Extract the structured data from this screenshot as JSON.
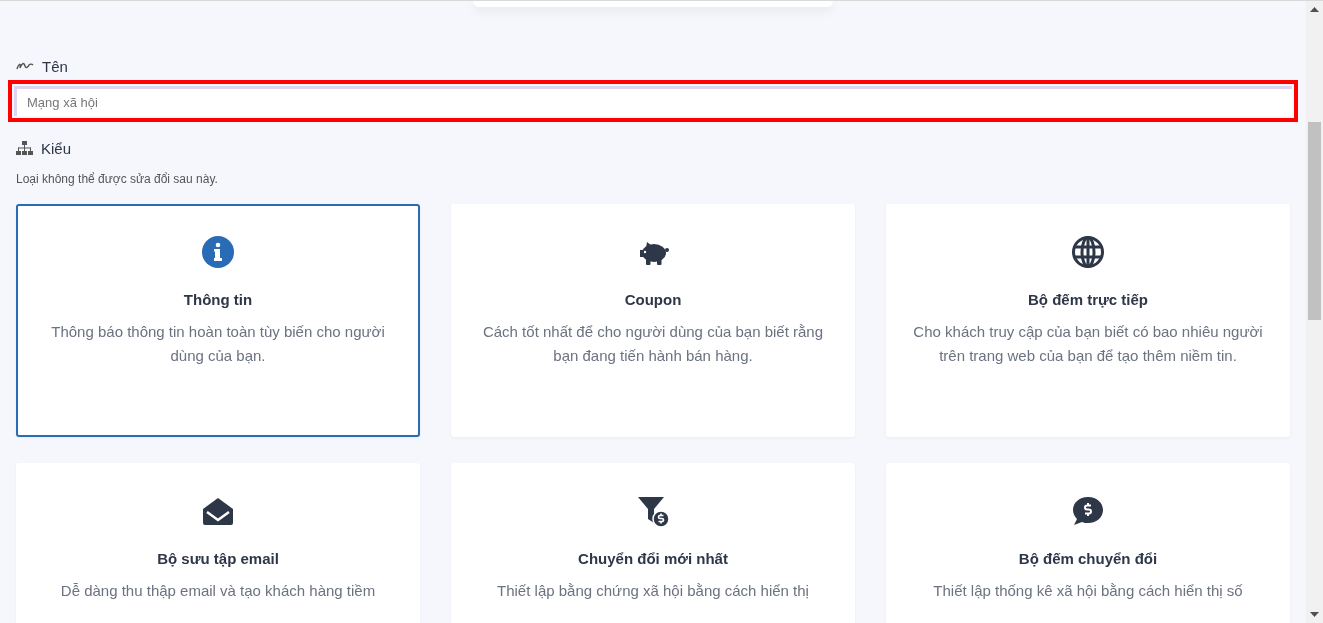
{
  "name_field": {
    "label": "Tên",
    "value": "Mạng xã hội",
    "highlighted": true
  },
  "type_section": {
    "label": "Kiểu",
    "hint": "Loại không thể được sửa đổi sau này."
  },
  "types": [
    {
      "kind": "info",
      "title": "Thông tin",
      "description": "Thông báo thông tin hoàn toàn tùy biến cho người dùng của bạn.",
      "selected": true
    },
    {
      "kind": "coupon",
      "title": "Coupon",
      "description": "Cách tốt nhất để cho người dùng của bạn biết rằng bạn đang tiến hành bán hàng.",
      "selected": false
    },
    {
      "kind": "visitors",
      "title": "Bộ đếm trực tiếp",
      "description": "Cho khách truy cập của bạn biết có bao nhiêu người trên trang web của bạn để tạo thêm niềm tin.",
      "selected": false
    },
    {
      "kind": "email",
      "title": "Bộ sưu tập email",
      "description": "Dễ dàng thu thập email và tạo khách hàng tiềm",
      "selected": false
    },
    {
      "kind": "conversions",
      "title": "Chuyển đổi mới nhất",
      "description": "Thiết lập bằng chứng xã hội bằng cách hiển thị",
      "selected": false
    },
    {
      "kind": "counter",
      "title": "Bộ đếm chuyển đổi",
      "description": "Thiết lập thống kê xã hội bằng cách hiển thị số",
      "selected": false
    }
  ]
}
